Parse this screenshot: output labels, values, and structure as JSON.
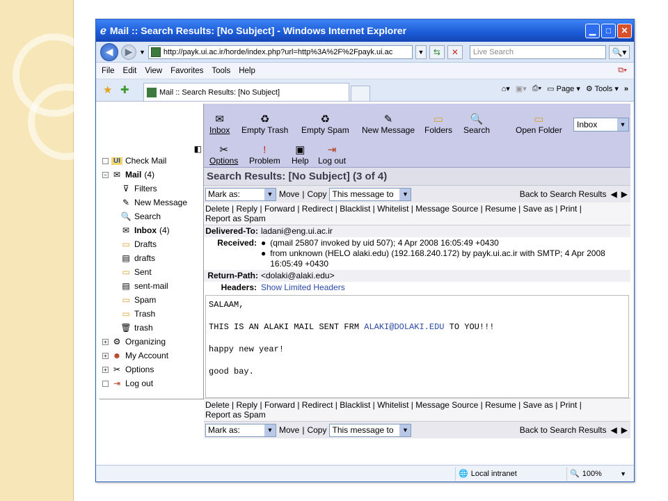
{
  "window": {
    "title": "Mail :: Search Results: [No Subject] - Windows Internet Explorer",
    "address": "http://payk.ui.ac.ir/horde/index.php?url=http%3A%2F%2Fpayk.ui.ac",
    "search_placeholder": "Live Search",
    "menu": [
      "File",
      "Edit",
      "View",
      "Favorites",
      "Tools",
      "Help"
    ],
    "tab_label": "Mail :: Search Results: [No Subject]",
    "page_label": "Page",
    "tools_label": "Tools"
  },
  "topnav": {
    "items": [
      "Inbox",
      "Empty Trash",
      "Empty Spam",
      "New Message",
      "Folders",
      "Search",
      "Open Folder"
    ],
    "items2": [
      "Options",
      "Problem",
      "Help",
      "Log out"
    ],
    "folder_select": "Inbox"
  },
  "sidebar": {
    "check_mail": "Check Mail",
    "mail_label": "Mail",
    "mail_count": "(4)",
    "items": [
      "Filters",
      "New Message",
      "Search",
      "Inbox",
      "Drafts",
      "drafts",
      "Sent",
      "sent-mail",
      "Spam",
      "Trash",
      "trash"
    ],
    "inbox_count": "(4)",
    "bottom": [
      "Organizing",
      "My Account",
      "Options",
      "Log out"
    ]
  },
  "main": {
    "heading": "Search Results: [No Subject] (3 of 4)",
    "mark_as": "Mark as:",
    "move": "Move",
    "copy": "Copy",
    "target": "This message to",
    "back": "Back to Search Results",
    "actions": [
      "Delete",
      "Reply",
      "Forward",
      "Redirect",
      "Blacklist",
      "Whitelist",
      "Message Source",
      "Resume",
      "Save as",
      "Print",
      "Report as Spam"
    ],
    "delivered_to_label": "Delivered-To:",
    "delivered_to": "ladani@eng.ui.ac.ir",
    "received_label": "Received:",
    "received": [
      "(qmail 25807 invoked by uid 507); 4 Apr 2008 16:05:49 +0430",
      "from unknown (HELO alaki.edu) (192.168.240.172) by payk.ui.ac.ir with SMTP; 4 Apr 2008 16:05:49 +0430"
    ],
    "return_path_label": "Return-Path:",
    "return_path": "<dolaki@alaki.edu>",
    "headers_label": "Headers:",
    "headers_link": "Show Limited Headers",
    "body": {
      "line1": "SALAAM,",
      "line2a": "THIS IS AN ALAKI MAIL SENT FRM ",
      "line2_link": "ALAKI@DOLAKI.EDU",
      "line2b": " TO YOU!!!",
      "line3": "happy new year!",
      "line4": "good bay."
    }
  },
  "status": {
    "zone": "Local intranet",
    "zoom": "100%"
  }
}
